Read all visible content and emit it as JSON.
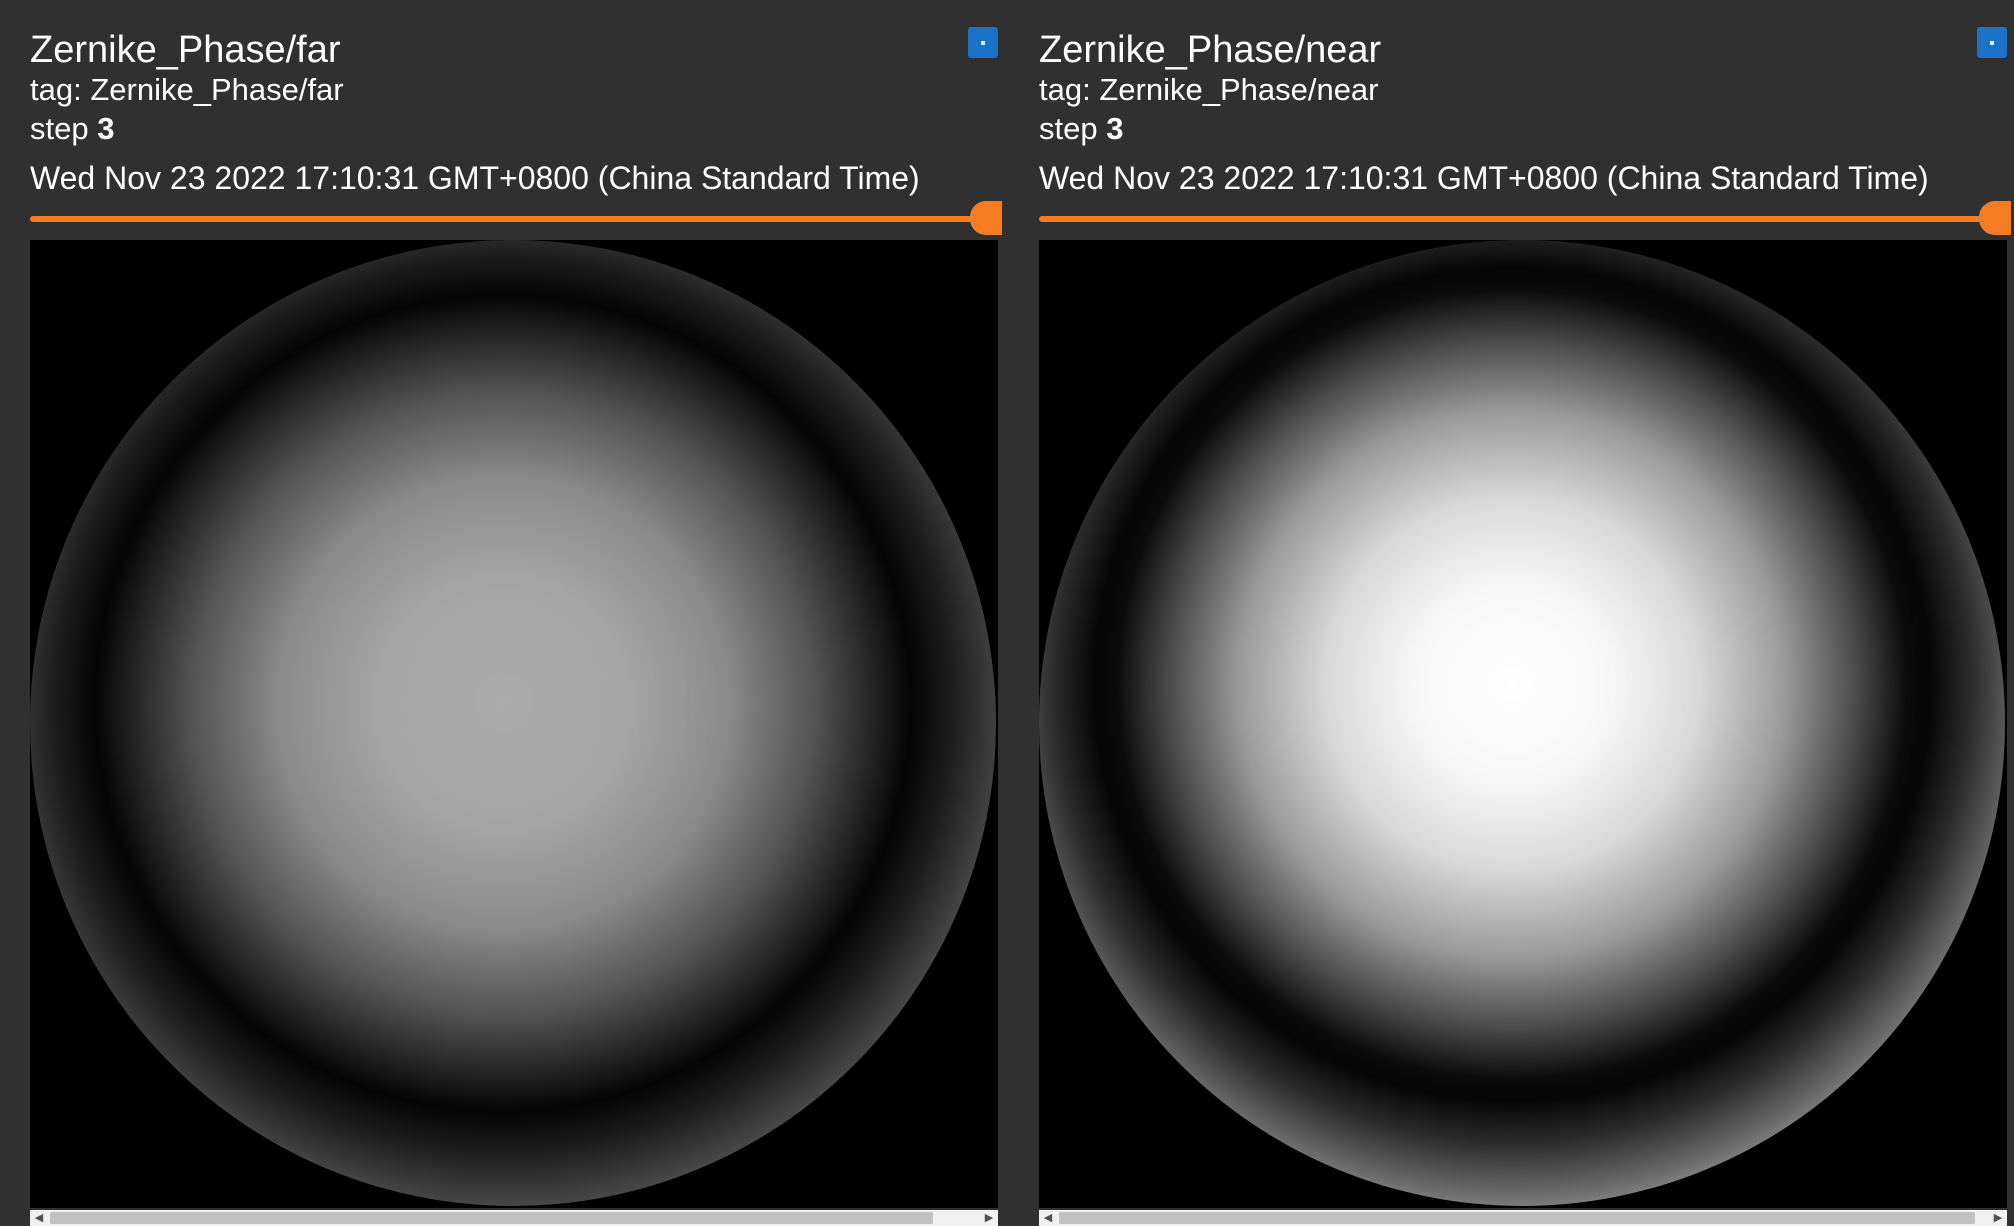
{
  "cards": [
    {
      "title": "Zernike_Phase/far",
      "tag_label": "tag: ",
      "tag": "Zernike_Phase/far",
      "step_label": "step ",
      "step": "3",
      "timestamp": "Wed Nov 23 2022 17:10:31 GMT+0800 (China Standard Time)"
    },
    {
      "title": "Zernike_Phase/near",
      "tag_label": "tag: ",
      "tag": "Zernike_Phase/near",
      "step_label": "step ",
      "step": "3",
      "timestamp": "Wed Nov 23 2022 17:10:31 GMT+0800 (China Standard Time)"
    }
  ],
  "icons": {
    "expand": "expand-icon",
    "scroll_left": "chevron-left-icon",
    "scroll_right": "chevron-right-icon"
  },
  "scroll_arrows": {
    "left": "◀",
    "right": "▶"
  },
  "colors": {
    "background": "#303030",
    "accent_slider": "#f57c20",
    "expand_button": "#1a73c8"
  }
}
